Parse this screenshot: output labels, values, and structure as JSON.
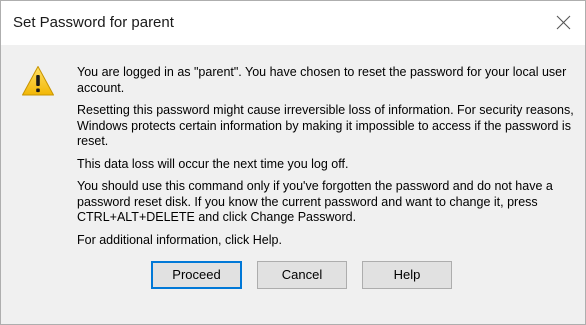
{
  "window": {
    "title": "Set Password for parent"
  },
  "icons": {
    "warning": "warning-icon",
    "close": "close-icon"
  },
  "colors": {
    "default_button_border": "#0078d7",
    "warning_fill": "#f5c518"
  },
  "message": {
    "paragraphs": [
      "You are logged in as \"parent\". You have chosen to reset the password for your local user account.",
      "Resetting this password might cause irreversible loss of information. For security reasons, Windows protects certain information by making it impossible to access if the password is reset.",
      "This data loss will occur the next time you log off.",
      "You should use this command only if you've forgotten the password and do not have a password reset disk. If you know the current password and want to change it, press CTRL+ALT+DELETE and click Change Password.",
      "For additional information, click Help."
    ]
  },
  "buttons": {
    "proceed": "Proceed",
    "cancel": "Cancel",
    "help": "Help"
  }
}
